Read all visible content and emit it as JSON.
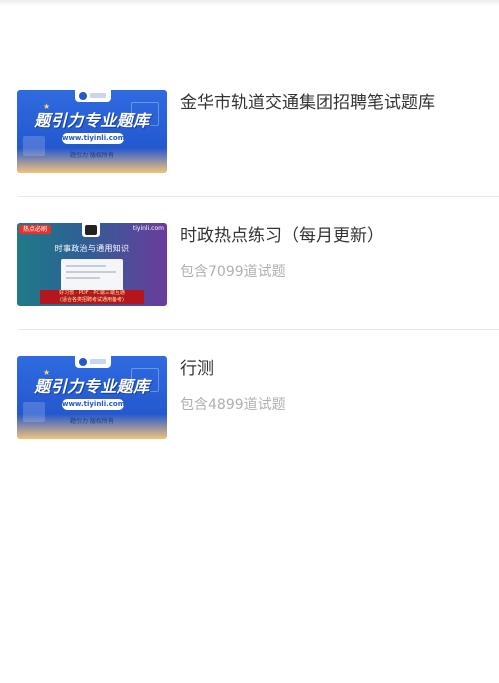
{
  "items": [
    {
      "title": "金华市轨道交通集团招聘笔试题库",
      "subtitle": "",
      "thumbnail": {
        "style": "brand",
        "headline": "题引力专业题库",
        "url": "www.tiyinli.com",
        "footer": "题引力 版权所有"
      }
    },
    {
      "title": "时政热点练习（每月更新）",
      "subtitle": "包含7099道试题",
      "thumbnail": {
        "style": "news",
        "tag": "热点必刷",
        "url": "tiyinli.com",
        "headline": "时事政治与通用知识",
        "banner_line1": "好习惯 · PDF · PC端三端互通",
        "banner_line2": "(适合各类招聘考试通用备考)"
      }
    },
    {
      "title": "行测",
      "subtitle": "包含4899道试题",
      "thumbnail": {
        "style": "brand",
        "headline": "题引力专业题库",
        "url": "www.tiyinli.com",
        "footer": "题引力 版权所有"
      }
    }
  ],
  "colors": {
    "title": "#333333",
    "subtitle": "#b0b0b0",
    "divider": "#e8e8e8",
    "brand_blue": "#2458cf",
    "banner_red": "#b3161c"
  }
}
